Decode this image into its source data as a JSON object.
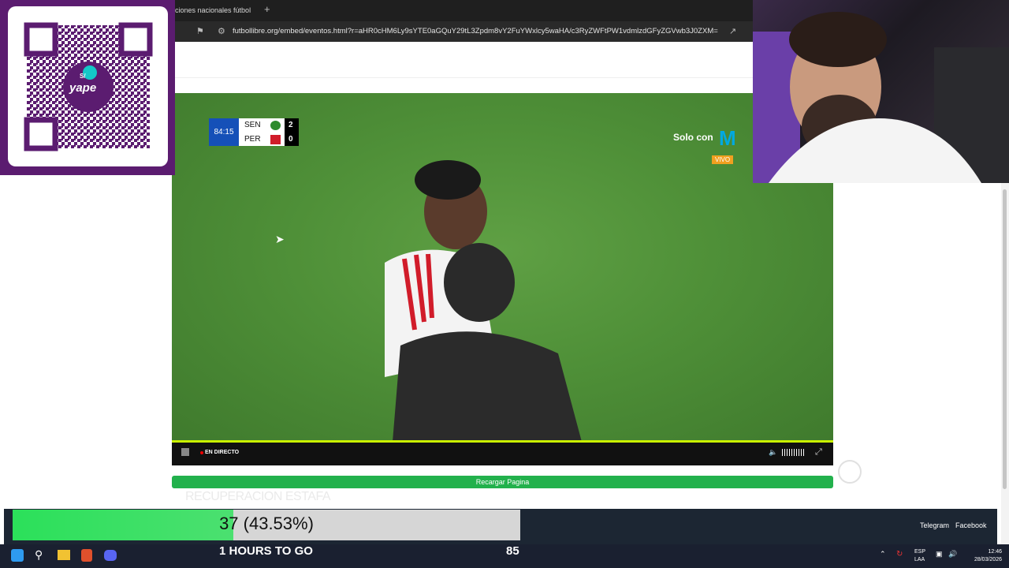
{
  "browser": {
    "tab_title": "ciones nacionales fútbol",
    "new_tab_icon": "+",
    "url": "futbollibre.org/embed/eventos.html?r=aHR0cHM6Ly9sYTE0aGQuY29tL3Zpdm8vY2FuYWxlcy5waHA/c3RyZWFtPW1vdmlzdGFyZGVwb3J0ZXM="
  },
  "scoreboard": {
    "time": "84:15",
    "team1": "SEN",
    "team2": "PER",
    "score1": "2",
    "score2": "0"
  },
  "broadcaster": {
    "label": "Solo con",
    "badge": "VIVO",
    "accent": "#00a9e0"
  },
  "player": {
    "live_label": "EN DIRECTO",
    "progress_color": "#c9f000",
    "reload_label": "Recargar Pagina"
  },
  "watermark": "RECUPERACION ESTAFA",
  "qr": {
    "brand": "yape",
    "symbol": "S/"
  },
  "goal": {
    "label": "37 (43.53%)",
    "progress": 0.4353,
    "subtitle": "1 HOURS TO GO",
    "target": "85"
  },
  "links": {
    "telegram": "Telegram",
    "facebook": "Facebook"
  },
  "taskbar": {
    "lang1": "ESP",
    "lang2": "LAA",
    "time": "12:46",
    "date": "28/03/2026"
  }
}
